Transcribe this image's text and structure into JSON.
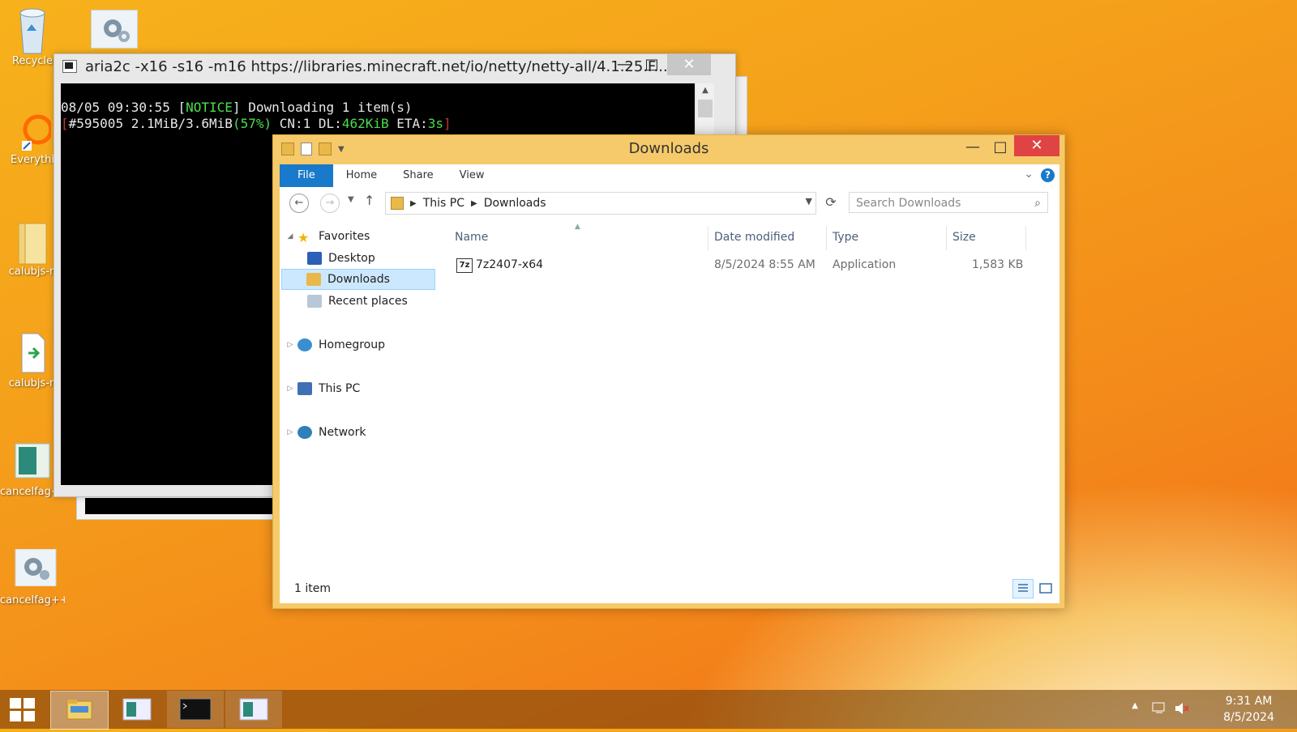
{
  "desktop": {
    "icons": [
      {
        "label": "Recycle",
        "icon": "recycle-bin-icon"
      },
      {
        "label": "Everythi",
        "icon": "everything-icon"
      },
      {
        "label": "calubjs-n",
        "icon": "folder-icon"
      },
      {
        "label": "calubjs-n",
        "icon": "file-shortcut-icon"
      },
      {
        "label": "cancelfag++",
        "icon": "app-icon"
      },
      {
        "label": "cancelfag++",
        "icon": "gear-icon"
      }
    ]
  },
  "console": {
    "title": "aria2c  -x16 -s16 -m16 https://libraries.minecraft.net/io/netty/netty-all/4.1.25.F...",
    "line1_pre": "08/05 09:30:55 [",
    "line1_notice": "NOTICE",
    "line1_post": "] Downloading 1 item(s)",
    "line2_open": "[",
    "line2_a": "#595005 2.1MiB/3.6MiB",
    "line2_pct": "(57%)",
    "line2_b": " CN:1 DL:",
    "line2_dl": "462KiB",
    "line2_c": " ETA:",
    "line2_eta": "3s",
    "line2_close": "]",
    "min": "—",
    "max": "□",
    "close": "✕"
  },
  "explorer": {
    "title": "Downloads",
    "min": "—",
    "max": "□",
    "close": "✕",
    "ribbon": {
      "file": "File",
      "home": "Home",
      "share": "Share",
      "view": "View",
      "help": "?"
    },
    "address": {
      "root": "This PC",
      "current": "Downloads"
    },
    "search_placeholder": "Search Downloads",
    "nav": {
      "favorites": "Favorites",
      "desktop": "Desktop",
      "downloads": "Downloads",
      "recent": "Recent places",
      "homegroup": "Homegroup",
      "thispc": "This PC",
      "network": "Network"
    },
    "columns": {
      "name": "Name",
      "date": "Date modified",
      "type": "Type",
      "size": "Size"
    },
    "files": [
      {
        "name": "7z2407-x64",
        "date": "8/5/2024 8:55 AM",
        "type": "Application",
        "size": "1,583 KB"
      }
    ],
    "status": "1 item"
  },
  "taskbar": {
    "time": "9:31 AM",
    "date": "8/5/2024"
  },
  "colors": {
    "accent": "#1979ca",
    "close_red": "#e04343",
    "selection": "#cce8ff"
  }
}
